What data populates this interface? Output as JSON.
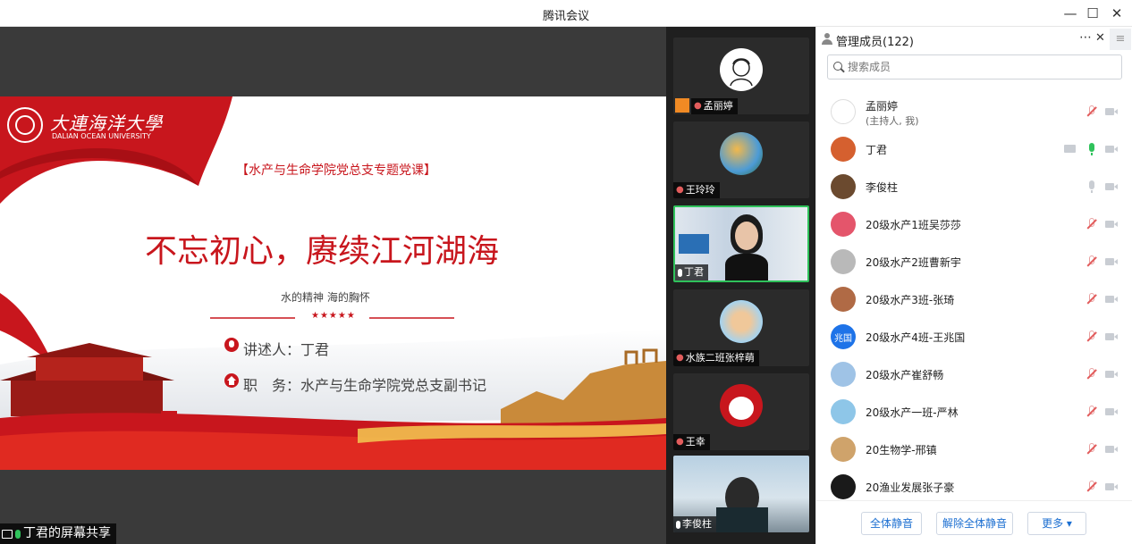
{
  "window": {
    "title": "腾讯会议"
  },
  "slide": {
    "logo_cn": "大連海洋大學",
    "logo_en": "DALIAN OCEAN UNIVERSITY",
    "course_tag": "【水产与生命学院党总支专题党课】",
    "headline": "不忘初心，赓续江河湖海",
    "subline": "水的精神 海的胸怀",
    "stars": "★★★★★",
    "speaker": "讲述人：丁君",
    "position": "职　务：水产与生命学院党总支副书记"
  },
  "share_label": "丁君的屏幕共享",
  "video_tiles": [
    {
      "name": "孟丽婷"
    },
    {
      "name": "王玲玲"
    },
    {
      "name": "丁君"
    },
    {
      "name": "水族二班张梓萌"
    },
    {
      "name": "王幸"
    },
    {
      "name": "李俊柱"
    }
  ],
  "panel": {
    "title": "管理成员(122)",
    "search_placeholder": "搜索成员",
    "members": [
      {
        "name": "孟丽婷",
        "role": "(主持人, 我)"
      },
      {
        "name": "丁君"
      },
      {
        "name": "李俊柱"
      },
      {
        "name": "20级水产1班吴莎莎"
      },
      {
        "name": "20级水产2班曹新宇"
      },
      {
        "name": "20级水产3班-张琦"
      },
      {
        "name": "20级水产4班-王兆国",
        "avatar_text": "兆国"
      },
      {
        "name": "20级水产崔舒畅"
      },
      {
        "name": "20级水产一班-严林"
      },
      {
        "name": "20生物学-邢镇"
      },
      {
        "name": "20渔业发展张子豪"
      }
    ],
    "footer": {
      "mute_all": "全体静音",
      "unmute_all": "解除全体静音",
      "more": "更多 ▾"
    }
  },
  "colors": {
    "accent": "#1c6fd1",
    "active_green": "#2fc25b",
    "slide_red": "#c8161d",
    "mute_red": "#e25c5c"
  }
}
